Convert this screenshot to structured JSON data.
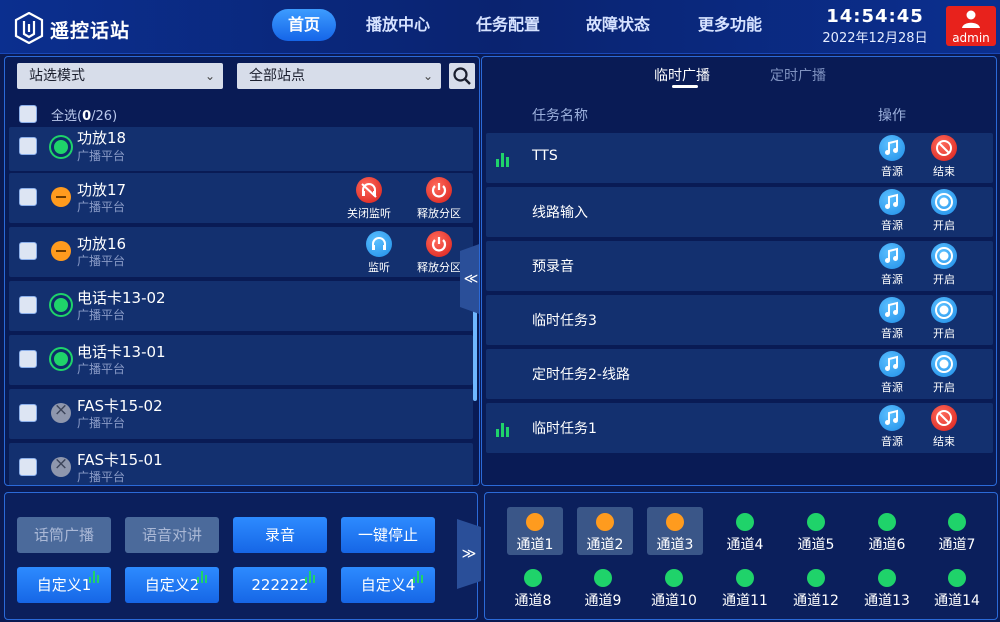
{
  "header": {
    "app_title": "遥控话站",
    "nav": [
      "首页",
      "播放中心",
      "任务配置",
      "故障状态",
      "更多功能"
    ],
    "time": "14:54:45",
    "date": "2022年12月28日",
    "user": "admin"
  },
  "left": {
    "site_mode": "站选模式",
    "all_sites": "全部站点",
    "select_all_label": "全选",
    "select_count": "0",
    "select_total": "/26)",
    "select_open": "(",
    "rows": [
      {
        "name": "功放18",
        "sub": "广播平台",
        "status": "ok"
      },
      {
        "name": "功放17",
        "sub": "广播平台",
        "status": "busy",
        "actions": [
          "关闭监听",
          "释放分区"
        ]
      },
      {
        "name": "功放16",
        "sub": "广播平台",
        "status": "busy",
        "actions": [
          "监听",
          "释放分区"
        ]
      },
      {
        "name": "电话卡13-02",
        "sub": "广播平台",
        "status": "ok"
      },
      {
        "name": "电话卡13-01",
        "sub": "广播平台",
        "status": "ok"
      },
      {
        "name": "FAS卡15-02",
        "sub": "广播平台",
        "status": "off"
      },
      {
        "name": "FAS卡15-01",
        "sub": "广播平台",
        "status": "off"
      }
    ],
    "collapse_glyph": "≪"
  },
  "right": {
    "tabs": [
      "临时广播",
      "定时广播"
    ],
    "col_task": "任务名称",
    "col_op": "操作",
    "tasks": [
      {
        "name": "TTS",
        "playing": true,
        "src": "音源",
        "op": "结束"
      },
      {
        "name": "线路输入",
        "playing": false,
        "src": "音源",
        "op": "开启"
      },
      {
        "name": "预录音",
        "playing": false,
        "src": "音源",
        "op": "开启"
      },
      {
        "name": "临时任务3",
        "playing": false,
        "src": "音源",
        "op": "开启"
      },
      {
        "name": "定时任务2-线路",
        "playing": false,
        "src": "音源",
        "op": "开启"
      },
      {
        "name": "临时任务1",
        "playing": true,
        "src": "音源",
        "op": "结束"
      }
    ]
  },
  "controls": {
    "buttons_row1": [
      "话筒广播",
      "语音对讲",
      "录音",
      "一键停止"
    ],
    "buttons_row2": [
      "自定义1",
      "自定义2",
      "222222",
      "自定义4"
    ],
    "expand_glyph": "≫"
  },
  "channels": {
    "row1": [
      "通道1",
      "通道2",
      "通道3",
      "通道4",
      "通道5",
      "通道6",
      "通道7"
    ],
    "row2": [
      "通道8",
      "通道9",
      "通道10",
      "通道11",
      "通道12",
      "通道13",
      "通道14"
    ],
    "selected": [
      "通道1",
      "通道2",
      "通道3"
    ]
  },
  "colors": {
    "accent": "#1f8ee8",
    "ok": "#1fd36a",
    "busy": "#ff9b1e",
    "danger": "#e8221c"
  }
}
